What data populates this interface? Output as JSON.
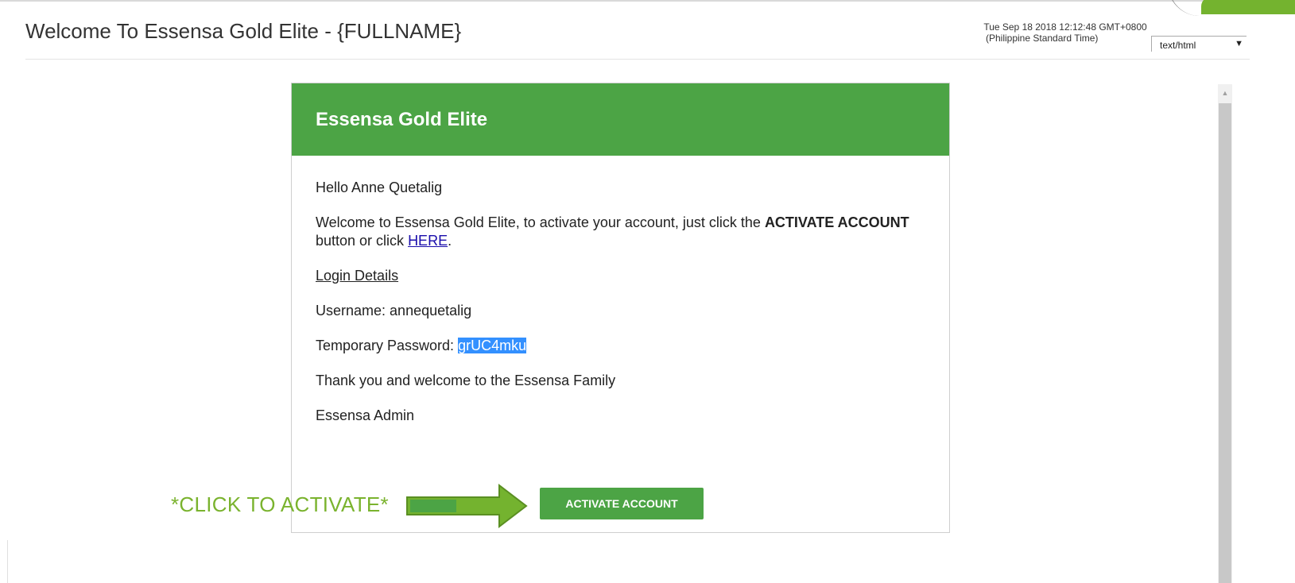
{
  "email": {
    "subject": "Welcome To Essensa Gold Elite - {FULLNAME}",
    "date_line1": "Tue Sep 18 2018 12:12:48 GMT+0800",
    "date_line2": "(Philippine Standard Time)",
    "mime_type": "text/html"
  },
  "card": {
    "header_title": "Essensa Gold Elite",
    "greeting": "Hello Anne Quetalig",
    "welcome_text_1": "Welcome to Essensa Gold Elite, to activate your account, just click the ",
    "welcome_bold": "ACTIVATE ACCOUNT",
    "welcome_text_2": " button or click ",
    "here_link": "HERE",
    "welcome_end": ".",
    "login_details": "Login Details",
    "username_label": "Username: ",
    "username_value": "annequetalig",
    "password_label": "Temporary Password: ",
    "password_value": "grUC4mku",
    "thanks": "Thank you and welcome to the Essensa Family",
    "signature": "Essensa Admin",
    "activate_button": "ACTIVATE ACCOUNT"
  },
  "annotation": {
    "text": "*CLICK TO ACTIVATE*",
    "color": "#7ab32e"
  },
  "colors": {
    "brand_green": "#4ca445",
    "link_blue": "#1a0dab",
    "selection_blue": "#3390ff"
  },
  "icons": {
    "scroll_up": "scroll-up-arrow-icon",
    "dropdown": "chevron-down-icon",
    "annotation_arrow": "right-arrow-icon"
  }
}
